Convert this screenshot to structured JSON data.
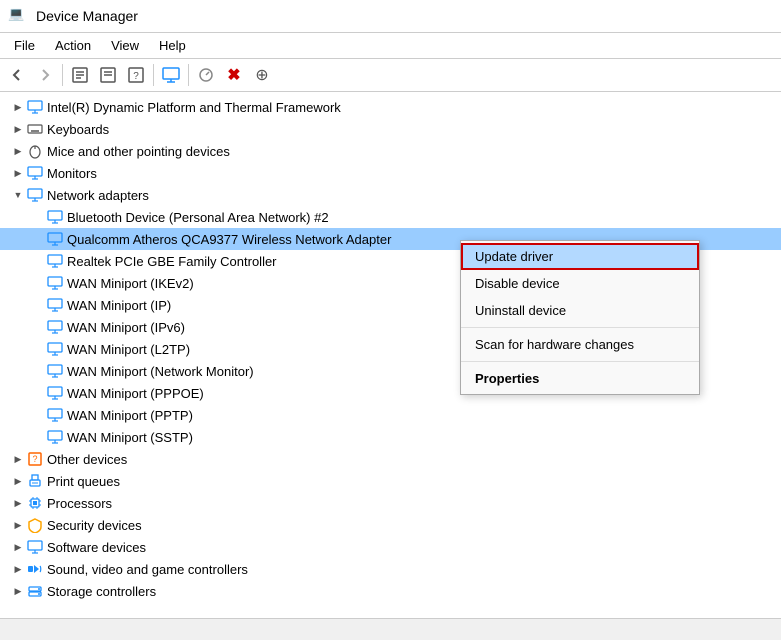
{
  "titleBar": {
    "title": "Device Manager",
    "icon": "💻"
  },
  "menuBar": {
    "items": [
      "File",
      "Action",
      "View",
      "Help"
    ]
  },
  "toolbar": {
    "buttons": [
      {
        "name": "back",
        "icon": "←"
      },
      {
        "name": "forward",
        "icon": "→"
      },
      {
        "name": "properties",
        "icon": "📋"
      },
      {
        "name": "update-driver",
        "icon": "📄"
      },
      {
        "name": "help",
        "icon": "❓"
      },
      {
        "name": "display-devices",
        "icon": "🖥"
      },
      {
        "name": "scan-hardware",
        "icon": "🔍"
      },
      {
        "name": "uninstall",
        "icon": "✖"
      },
      {
        "name": "add-driver",
        "icon": "⊕"
      }
    ]
  },
  "treeItems": [
    {
      "id": "intel",
      "level": 1,
      "expanded": false,
      "arrow": "▶",
      "icon": "💻",
      "label": "Intel(R) Dynamic Platform and Thermal Framework",
      "selected": false
    },
    {
      "id": "keyboards",
      "level": 1,
      "expanded": false,
      "arrow": "▶",
      "icon": "⌨",
      "label": "Keyboards",
      "selected": false
    },
    {
      "id": "mice",
      "level": 1,
      "expanded": false,
      "arrow": "▶",
      "icon": "🖱",
      "label": "Mice and other pointing devices",
      "selected": false
    },
    {
      "id": "monitors",
      "level": 1,
      "expanded": false,
      "arrow": "▶",
      "icon": "🖥",
      "label": "Monitors",
      "selected": false
    },
    {
      "id": "network",
      "level": 1,
      "expanded": true,
      "arrow": "▼",
      "icon": "🖥",
      "label": "Network adapters",
      "selected": false
    },
    {
      "id": "bluetooth",
      "level": 2,
      "expanded": false,
      "arrow": "",
      "icon": "🖥",
      "label": "Bluetooth Device (Personal Area Network) #2",
      "selected": false
    },
    {
      "id": "qualcomm",
      "level": 2,
      "expanded": false,
      "arrow": "",
      "icon": "🖥",
      "label": "Qualcomm Atheros QCA9377 Wireless Network Adapter",
      "selected": true
    },
    {
      "id": "realtek",
      "level": 2,
      "expanded": false,
      "arrow": "",
      "icon": "🖥",
      "label": "Realtek PCIe GBE Family Controller",
      "selected": false
    },
    {
      "id": "wan-ikev2",
      "level": 2,
      "expanded": false,
      "arrow": "",
      "icon": "🖥",
      "label": "WAN Miniport (IKEv2)",
      "selected": false
    },
    {
      "id": "wan-ip",
      "level": 2,
      "expanded": false,
      "arrow": "",
      "icon": "🖥",
      "label": "WAN Miniport (IP)",
      "selected": false
    },
    {
      "id": "wan-ipv6",
      "level": 2,
      "expanded": false,
      "arrow": "",
      "icon": "🖥",
      "label": "WAN Miniport (IPv6)",
      "selected": false
    },
    {
      "id": "wan-l2tp",
      "level": 2,
      "expanded": false,
      "arrow": "",
      "icon": "🖥",
      "label": "WAN Miniport (L2TP)",
      "selected": false
    },
    {
      "id": "wan-netmon",
      "level": 2,
      "expanded": false,
      "arrow": "",
      "icon": "🖥",
      "label": "WAN Miniport (Network Monitor)",
      "selected": false
    },
    {
      "id": "wan-pppoe",
      "level": 2,
      "expanded": false,
      "arrow": "",
      "icon": "🖥",
      "label": "WAN Miniport (PPPOE)",
      "selected": false
    },
    {
      "id": "wan-pptp",
      "level": 2,
      "expanded": false,
      "arrow": "",
      "icon": "🖥",
      "label": "WAN Miniport (PPTP)",
      "selected": false
    },
    {
      "id": "wan-sstp",
      "level": 2,
      "expanded": false,
      "arrow": "",
      "icon": "🖥",
      "label": "WAN Miniport (SSTP)",
      "selected": false
    },
    {
      "id": "other",
      "level": 1,
      "expanded": false,
      "arrow": "▶",
      "icon": "❓",
      "label": "Other devices",
      "selected": false
    },
    {
      "id": "print",
      "level": 1,
      "expanded": false,
      "arrow": "▶",
      "icon": "🖨",
      "label": "Print queues",
      "selected": false
    },
    {
      "id": "processors",
      "level": 1,
      "expanded": false,
      "arrow": "▶",
      "icon": "💻",
      "label": "Processors",
      "selected": false
    },
    {
      "id": "security",
      "level": 1,
      "expanded": false,
      "arrow": "▶",
      "icon": "🔒",
      "label": "Security devices",
      "selected": false
    },
    {
      "id": "software",
      "level": 1,
      "expanded": false,
      "arrow": "▶",
      "icon": "💻",
      "label": "Software devices",
      "selected": false
    },
    {
      "id": "sound",
      "level": 1,
      "expanded": false,
      "arrow": "▶",
      "icon": "🔊",
      "label": "Sound, video and game controllers",
      "selected": false
    },
    {
      "id": "storage",
      "level": 1,
      "expanded": false,
      "arrow": "▶",
      "icon": "💾",
      "label": "Storage controllers",
      "selected": false
    }
  ],
  "contextMenu": {
    "visible": true,
    "items": [
      {
        "id": "update",
        "label": "Update driver",
        "type": "active"
      },
      {
        "id": "disable",
        "label": "Disable device",
        "type": "normal"
      },
      {
        "id": "uninstall",
        "label": "Uninstall device",
        "type": "normal"
      },
      {
        "id": "sep1",
        "type": "separator"
      },
      {
        "id": "scan",
        "label": "Scan for hardware changes",
        "type": "normal"
      },
      {
        "id": "sep2",
        "type": "separator"
      },
      {
        "id": "props",
        "label": "Properties",
        "type": "bold"
      }
    ]
  },
  "statusBar": {
    "text": ""
  }
}
